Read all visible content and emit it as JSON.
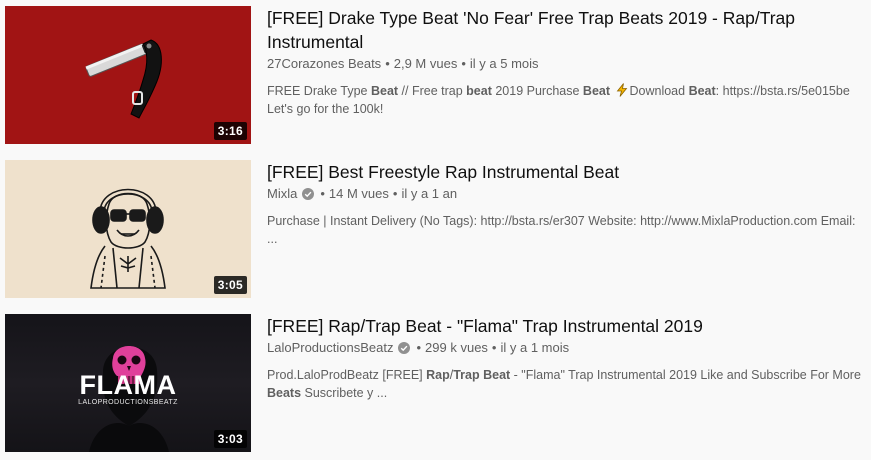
{
  "videos": [
    {
      "title": "[FREE] Drake Type Beat 'No Fear' Free Trap Beats 2019 - Rap/Trap Instrumental",
      "channel": "27Corazones Beats",
      "verified": false,
      "views": "2,9 M vues",
      "age": "il y a 5 mois",
      "duration": "3:16",
      "description": [
        {
          "t": "FREE Drake Type ",
          "b": false
        },
        {
          "t": "Beat",
          "b": true
        },
        {
          "t": " // Free trap ",
          "b": false
        },
        {
          "t": "beat",
          "b": true
        },
        {
          "t": " 2019 Purchase ",
          "b": false
        },
        {
          "t": "Beat",
          "b": true
        },
        {
          "t": " ",
          "b": false
        },
        {
          "icon": "lightning-icon"
        },
        {
          "t": "Download ",
          "b": false
        },
        {
          "t": "Beat",
          "b": true
        },
        {
          "t": ": https://bsta.rs/5e015be Let's go for the 100k!",
          "b": false
        }
      ]
    },
    {
      "title": "[FREE] Best Freestyle Rap Instrumental Beat",
      "channel": "Mixla",
      "verified": true,
      "views": "14 M vues",
      "age": "il y a 1 an",
      "duration": "3:05",
      "description": [
        {
          "t": "Purchase | Instant Delivery (No Tags): http://bsta.rs/er307 Website: http://www.MixlaProduction.com Email: ...",
          "b": false
        }
      ]
    },
    {
      "title": "[FREE] Rap/Trap Beat - \"Flama\" Trap Instrumental 2019",
      "channel": "LaloProductionsBeatz",
      "verified": true,
      "views": "299 k vues",
      "age": "il y a 1 mois",
      "duration": "3:03",
      "thumb_text": "FLAMA",
      "thumb_subtext": "LALOPRODUCTIONSBEATZ",
      "description": [
        {
          "t": "Prod.LaloProdBeatz [FREE] ",
          "b": false
        },
        {
          "t": "Rap",
          "b": true
        },
        {
          "t": "/",
          "b": false
        },
        {
          "t": "Trap",
          "b": true
        },
        {
          "t": " ",
          "b": false
        },
        {
          "t": "Beat",
          "b": true
        },
        {
          "t": " - \"Flama\" Trap Instrumental 2019 Like and Subscribe For More ",
          "b": false
        },
        {
          "t": "Beats",
          "b": true
        },
        {
          "t": " Suscribete y ...",
          "b": false
        }
      ]
    }
  ],
  "separator": "•",
  "colors": {
    "background": "#f9f9f9",
    "title": "#0f0f0f",
    "meta": "#606060",
    "thumb1_bg": "#a11414",
    "thumb2_bg": "#efe1cc",
    "thumb3_bg": "#1a191e",
    "skull_pink": "#e0409b"
  }
}
